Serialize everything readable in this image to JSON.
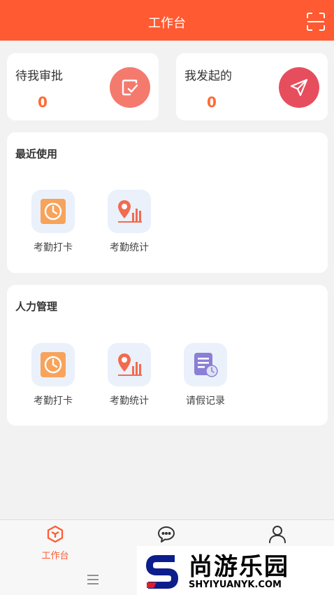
{
  "header": {
    "title": "工作台",
    "scan_icon": "scan-icon"
  },
  "summary": [
    {
      "label": "待我审批",
      "count": "0",
      "icon": "approve-icon",
      "color": "#f47a6e"
    },
    {
      "label": "我发起的",
      "count": "0",
      "icon": "send-icon",
      "color": "#e64e5e"
    }
  ],
  "recent": {
    "title": "最近使用",
    "apps": [
      {
        "label": "考勤打卡",
        "icon": "attendance-clock-icon"
      },
      {
        "label": "考勤统计",
        "icon": "attendance-stats-icon"
      }
    ]
  },
  "hr": {
    "title": "人力管理",
    "apps": [
      {
        "label": "考勤打卡",
        "icon": "attendance-clock-icon"
      },
      {
        "label": "考勤统计",
        "icon": "attendance-stats-icon"
      },
      {
        "label": "请假记录",
        "icon": "leave-record-icon"
      }
    ]
  },
  "tabbar": {
    "active_label": "工作台",
    "active_color": "#ff5a32",
    "tabs": [
      "workbench-tab",
      "message-tab",
      "profile-tab"
    ]
  },
  "watermark": {
    "text": "尚游乐园",
    "url": "SHYIYUANYK.COM"
  }
}
